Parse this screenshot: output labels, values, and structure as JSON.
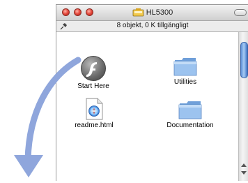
{
  "window": {
    "title": "HL5300",
    "status": "8 objekt, 0 K tillgängligt"
  },
  "items": [
    {
      "label": "Start Here",
      "icon": "flash-icon"
    },
    {
      "label": "Utilities",
      "icon": "folder-icon"
    },
    {
      "label": "readme.html",
      "icon": "html-document-icon"
    },
    {
      "label": "Documentation",
      "icon": "folder-icon"
    }
  ],
  "colors": {
    "arrow": "#8fa6dc",
    "folder": "#8fb7e8",
    "scroll_thumb": "#5c8fd6"
  }
}
